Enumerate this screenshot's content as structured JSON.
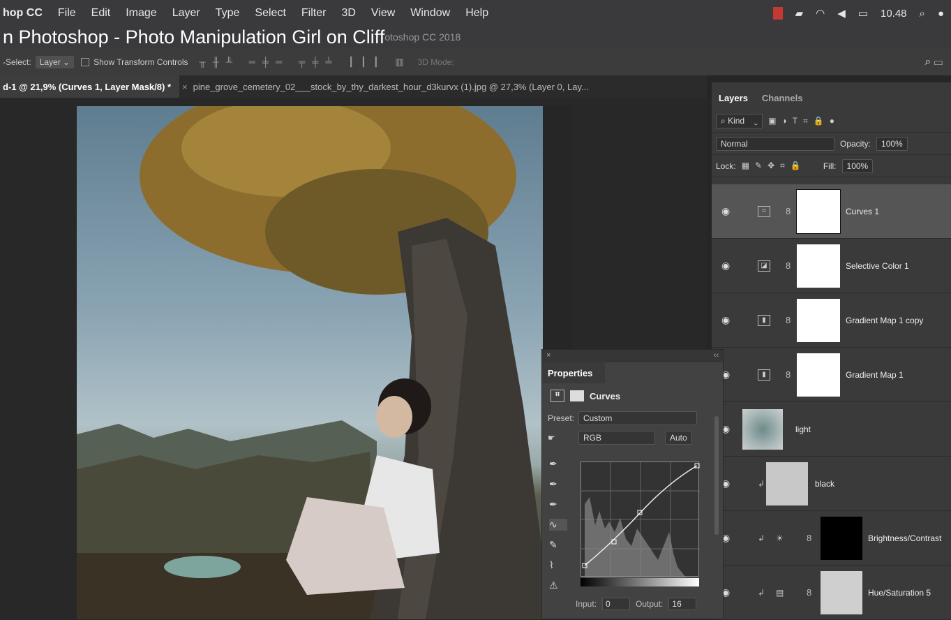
{
  "menubar": {
    "app": "hop CC",
    "items": [
      "File",
      "Edit",
      "Image",
      "Layer",
      "Type",
      "Select",
      "Filter",
      "3D",
      "View",
      "Window",
      "Help"
    ],
    "clock": "10.48"
  },
  "title": {
    "video_title": "n Photoshop - Photo Manipulation Girl on Cliff",
    "window_title": "otoshop CC 2018"
  },
  "options_bar": {
    "auto_select_label": "-Select:",
    "auto_select_value": "Layer",
    "show_transform": "Show Transform Controls",
    "mode_label": "3D Mode:"
  },
  "doc_tabs": [
    {
      "label": "d-1 @ 21,9% (Curves 1, Layer Mask/8) *"
    },
    {
      "label": "pine_grove_cemetery_02___stock_by_thy_darkest_hour_d3kurvx (1).jpg @ 27,3% (Layer 0, Lay..."
    }
  ],
  "layers_panel": {
    "tabs": [
      "Layers",
      "Channels"
    ],
    "filter_label": "Kind",
    "blend_mode": "Normal",
    "opacity_label": "Opacity:",
    "opacity_value": "100%",
    "lock_label": "Lock:",
    "fill_label": "Fill:",
    "fill_value": "100%",
    "layers": [
      {
        "name": "Curves 1"
      },
      {
        "name": "Selective Color 1"
      },
      {
        "name": "Gradient Map 1 copy"
      },
      {
        "name": "Gradient Map 1"
      },
      {
        "name": "light"
      },
      {
        "name": "black"
      },
      {
        "name": "Brightness/Contrast"
      },
      {
        "name": "Hue/Saturation 5"
      }
    ]
  },
  "properties": {
    "title": "Properties",
    "adjustment": "Curves",
    "preset_label": "Preset:",
    "preset_value": "Custom",
    "channel": "RGB",
    "auto_button": "Auto",
    "input_label": "Input:",
    "input_value": "0",
    "output_label": "Output:",
    "output_value": "16"
  }
}
